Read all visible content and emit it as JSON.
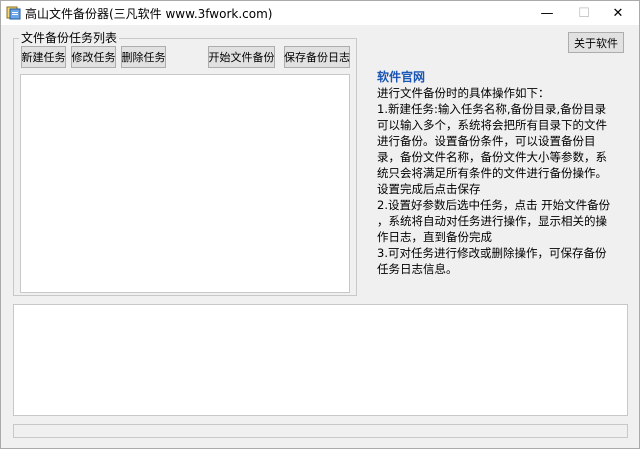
{
  "window": {
    "title": "高山文件备份器(三凡软件 www.3fwork.com)",
    "controls": {
      "minimize": "—",
      "maximize": "☐",
      "close": "✕"
    }
  },
  "group": {
    "label": "文件备份任务列表"
  },
  "toolbar": {
    "new_task": "新建任务",
    "edit_task": "修改任务",
    "delete_task": "删除任务",
    "start_backup": "开始文件备份",
    "save_log": "保存备份日志"
  },
  "about_button": "关于软件",
  "info": {
    "link": "软件官网",
    "lines": [
      "进行文件备份时的具体操作如下：",
      "1.新建任务:输入任务名称,备份目录,备份目录可以输入多个，系统将会把所有目录下的文件进行备份。设置备份条件，可以设置备份目录，备份文件名称，备份文件大小等参数，系统只会将满足所有条件的文件进行备份操作。设置完成后点击保存",
      "2.设置好参数后选中任务，点击 开始文件备份 ，系统将自动对任务进行操作，显示相关的操作日志，直到备份完成",
      "3.可对任务进行修改或删除操作，可保存备份任务日志信息。"
    ]
  },
  "colors": {
    "link": "#1a56b6",
    "background": "#f0f0f0"
  }
}
